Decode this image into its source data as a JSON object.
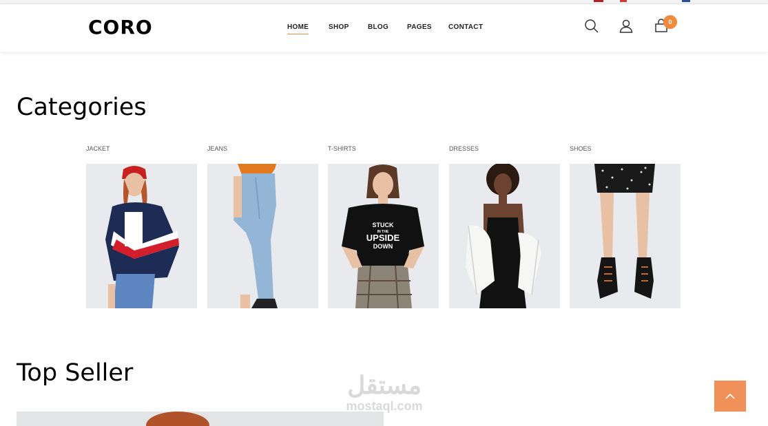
{
  "brand": {
    "logo": "CORO"
  },
  "nav": {
    "items": [
      {
        "label": "HOME"
      },
      {
        "label": "SHOP"
      },
      {
        "label": "BLOG"
      },
      {
        "label": "PAGES"
      },
      {
        "label": "CONTACT"
      }
    ],
    "active": "HOME"
  },
  "header_icons": [
    "search-icon",
    "user-icon",
    "cart-icon"
  ],
  "cart": {
    "count": "0"
  },
  "colors": {
    "accent": "#f08b3d",
    "scroll_button": "#f0915a",
    "image_bg": "#e9eaed"
  },
  "categories": {
    "title": "Categories",
    "items": [
      {
        "label": "JACKET"
      },
      {
        "label": "JEANS"
      },
      {
        "label": "T-SHIRTS",
        "shirt_text_1": "STUCK",
        "shirt_text_2": "IN THE",
        "shirt_text_3": "UPSIDE",
        "shirt_text_4": "DOWN"
      },
      {
        "label": "DRESSES"
      },
      {
        "label": "SHOES"
      }
    ]
  },
  "top_seller": {
    "title": "Top Seller"
  },
  "watermark": {
    "arabic": "مستقل",
    "latin": "mostaql.com"
  },
  "scroll_top": {
    "icon": "chevron-up-icon"
  }
}
